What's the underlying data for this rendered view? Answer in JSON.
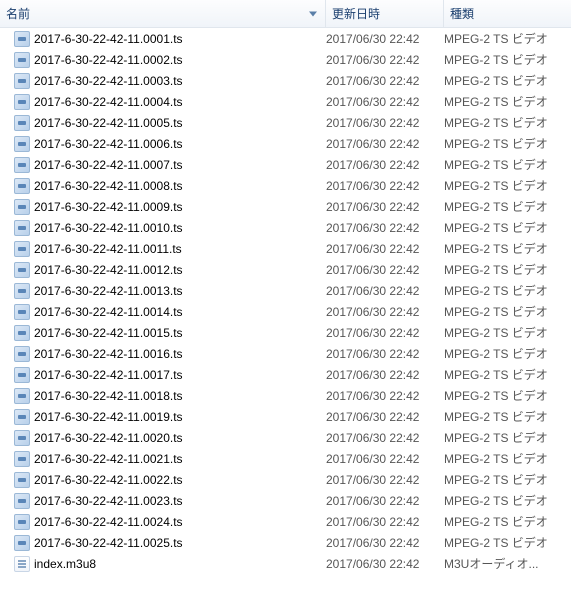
{
  "columns": {
    "name": "名前",
    "date": "更新日時",
    "type": "種類"
  },
  "files": [
    {
      "name": "2017-6-30-22-42-11.0001.ts",
      "date": "2017/06/30 22:42",
      "type": "MPEG-2 TS ビデオ",
      "icon": "ts"
    },
    {
      "name": "2017-6-30-22-42-11.0002.ts",
      "date": "2017/06/30 22:42",
      "type": "MPEG-2 TS ビデオ",
      "icon": "ts"
    },
    {
      "name": "2017-6-30-22-42-11.0003.ts",
      "date": "2017/06/30 22:42",
      "type": "MPEG-2 TS ビデオ",
      "icon": "ts"
    },
    {
      "name": "2017-6-30-22-42-11.0004.ts",
      "date": "2017/06/30 22:42",
      "type": "MPEG-2 TS ビデオ",
      "icon": "ts"
    },
    {
      "name": "2017-6-30-22-42-11.0005.ts",
      "date": "2017/06/30 22:42",
      "type": "MPEG-2 TS ビデオ",
      "icon": "ts"
    },
    {
      "name": "2017-6-30-22-42-11.0006.ts",
      "date": "2017/06/30 22:42",
      "type": "MPEG-2 TS ビデオ",
      "icon": "ts"
    },
    {
      "name": "2017-6-30-22-42-11.0007.ts",
      "date": "2017/06/30 22:42",
      "type": "MPEG-2 TS ビデオ",
      "icon": "ts"
    },
    {
      "name": "2017-6-30-22-42-11.0008.ts",
      "date": "2017/06/30 22:42",
      "type": "MPEG-2 TS ビデオ",
      "icon": "ts"
    },
    {
      "name": "2017-6-30-22-42-11.0009.ts",
      "date": "2017/06/30 22:42",
      "type": "MPEG-2 TS ビデオ",
      "icon": "ts"
    },
    {
      "name": "2017-6-30-22-42-11.0010.ts",
      "date": "2017/06/30 22:42",
      "type": "MPEG-2 TS ビデオ",
      "icon": "ts"
    },
    {
      "name": "2017-6-30-22-42-11.0011.ts",
      "date": "2017/06/30 22:42",
      "type": "MPEG-2 TS ビデオ",
      "icon": "ts"
    },
    {
      "name": "2017-6-30-22-42-11.0012.ts",
      "date": "2017/06/30 22:42",
      "type": "MPEG-2 TS ビデオ",
      "icon": "ts"
    },
    {
      "name": "2017-6-30-22-42-11.0013.ts",
      "date": "2017/06/30 22:42",
      "type": "MPEG-2 TS ビデオ",
      "icon": "ts"
    },
    {
      "name": "2017-6-30-22-42-11.0014.ts",
      "date": "2017/06/30 22:42",
      "type": "MPEG-2 TS ビデオ",
      "icon": "ts"
    },
    {
      "name": "2017-6-30-22-42-11.0015.ts",
      "date": "2017/06/30 22:42",
      "type": "MPEG-2 TS ビデオ",
      "icon": "ts"
    },
    {
      "name": "2017-6-30-22-42-11.0016.ts",
      "date": "2017/06/30 22:42",
      "type": "MPEG-2 TS ビデオ",
      "icon": "ts"
    },
    {
      "name": "2017-6-30-22-42-11.0017.ts",
      "date": "2017/06/30 22:42",
      "type": "MPEG-2 TS ビデオ",
      "icon": "ts"
    },
    {
      "name": "2017-6-30-22-42-11.0018.ts",
      "date": "2017/06/30 22:42",
      "type": "MPEG-2 TS ビデオ",
      "icon": "ts"
    },
    {
      "name": "2017-6-30-22-42-11.0019.ts",
      "date": "2017/06/30 22:42",
      "type": "MPEG-2 TS ビデオ",
      "icon": "ts"
    },
    {
      "name": "2017-6-30-22-42-11.0020.ts",
      "date": "2017/06/30 22:42",
      "type": "MPEG-2 TS ビデオ",
      "icon": "ts"
    },
    {
      "name": "2017-6-30-22-42-11.0021.ts",
      "date": "2017/06/30 22:42",
      "type": "MPEG-2 TS ビデオ",
      "icon": "ts"
    },
    {
      "name": "2017-6-30-22-42-11.0022.ts",
      "date": "2017/06/30 22:42",
      "type": "MPEG-2 TS ビデオ",
      "icon": "ts"
    },
    {
      "name": "2017-6-30-22-42-11.0023.ts",
      "date": "2017/06/30 22:42",
      "type": "MPEG-2 TS ビデオ",
      "icon": "ts"
    },
    {
      "name": "2017-6-30-22-42-11.0024.ts",
      "date": "2017/06/30 22:42",
      "type": "MPEG-2 TS ビデオ",
      "icon": "ts"
    },
    {
      "name": "2017-6-30-22-42-11.0025.ts",
      "date": "2017/06/30 22:42",
      "type": "MPEG-2 TS ビデオ",
      "icon": "ts"
    },
    {
      "name": "index.m3u8",
      "date": "2017/06/30 22:42",
      "type": "M3Uオーディオ...",
      "icon": "m3u8"
    }
  ]
}
